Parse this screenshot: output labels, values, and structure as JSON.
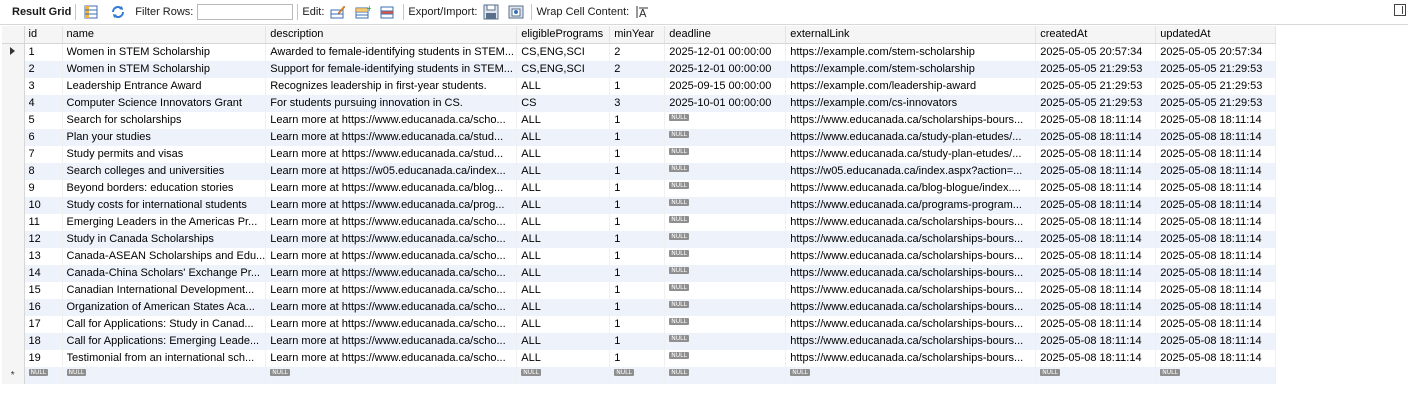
{
  "toolbar": {
    "result_grid": "Result Grid",
    "filter_rows": "Filter Rows:",
    "filter_value": "",
    "edit": "Edit:",
    "export_import": "Export/Import:",
    "wrap_cell": "Wrap Cell Content:"
  },
  "null_label": "NULL",
  "columns": [
    "id",
    "name",
    "description",
    "eligiblePrograms",
    "minYear",
    "deadline",
    "externalLink",
    "createdAt",
    "updatedAt"
  ],
  "rows": [
    [
      "1",
      "Women in STEM Scholarship",
      "Awarded to female-identifying students in STEM...",
      "CS,ENG,SCI",
      "2",
      "2025-12-01 00:00:00",
      "https://example.com/stem-scholarship",
      "2025-05-05 20:57:34",
      "2025-05-05 20:57:34"
    ],
    [
      "2",
      "Women in STEM Scholarship",
      "Support for female-identifying students in STEM...",
      "CS,ENG,SCI",
      "2",
      "2025-12-01 00:00:00",
      "https://example.com/stem-scholarship",
      "2025-05-05 21:29:53",
      "2025-05-05 21:29:53"
    ],
    [
      "3",
      "Leadership Entrance Award",
      "Recognizes leadership in first-year students.",
      "ALL",
      "1",
      "2025-09-15 00:00:00",
      "https://example.com/leadership-award",
      "2025-05-05 21:29:53",
      "2025-05-05 21:29:53"
    ],
    [
      "4",
      "Computer Science Innovators Grant",
      "For students pursuing innovation in CS.",
      "CS",
      "3",
      "2025-10-01 00:00:00",
      "https://example.com/cs-innovators",
      "2025-05-05 21:29:53",
      "2025-05-05 21:29:53"
    ],
    [
      "5",
      "Search for scholarships",
      "Learn more at https://www.educanada.ca/scho...",
      "ALL",
      "1",
      null,
      "https://www.educanada.ca/scholarships-bours...",
      "2025-05-08 18:11:14",
      "2025-05-08 18:11:14"
    ],
    [
      "6",
      "Plan your studies",
      "Learn more at https://www.educanada.ca/stud...",
      "ALL",
      "1",
      null,
      "https://www.educanada.ca/study-plan-etudes/...",
      "2025-05-08 18:11:14",
      "2025-05-08 18:11:14"
    ],
    [
      "7",
      "Study permits and visas",
      "Learn more at https://www.educanada.ca/stud...",
      "ALL",
      "1",
      null,
      "https://www.educanada.ca/study-plan-etudes/...",
      "2025-05-08 18:11:14",
      "2025-05-08 18:11:14"
    ],
    [
      "8",
      "Search colleges and universities",
      "Learn more at https://w05.educanada.ca/index...",
      "ALL",
      "1",
      null,
      "https://w05.educanada.ca/index.aspx?action=...",
      "2025-05-08 18:11:14",
      "2025-05-08 18:11:14"
    ],
    [
      "9",
      "Beyond borders: education stories",
      "Learn more at https://www.educanada.ca/blog...",
      "ALL",
      "1",
      null,
      "https://www.educanada.ca/blog-blogue/index....",
      "2025-05-08 18:11:14",
      "2025-05-08 18:11:14"
    ],
    [
      "10",
      "Study costs for international students",
      "Learn more at https://www.educanada.ca/prog...",
      "ALL",
      "1",
      null,
      "https://www.educanada.ca/programs-program...",
      "2025-05-08 18:11:14",
      "2025-05-08 18:11:14"
    ],
    [
      "11",
      "Emerging Leaders in the Americas Pr...",
      "Learn more at https://www.educanada.ca/scho...",
      "ALL",
      "1",
      null,
      "https://www.educanada.ca/scholarships-bours...",
      "2025-05-08 18:11:14",
      "2025-05-08 18:11:14"
    ],
    [
      "12",
      "Study in Canada Scholarships",
      "Learn more at https://www.educanada.ca/scho...",
      "ALL",
      "1",
      null,
      "https://www.educanada.ca/scholarships-bours...",
      "2025-05-08 18:11:14",
      "2025-05-08 18:11:14"
    ],
    [
      "13",
      "Canada-ASEAN Scholarships and Edu...",
      "Learn more at https://www.educanada.ca/scho...",
      "ALL",
      "1",
      null,
      "https://www.educanada.ca/scholarships-bours...",
      "2025-05-08 18:11:14",
      "2025-05-08 18:11:14"
    ],
    [
      "14",
      "Canada-China Scholars' Exchange Pr...",
      "Learn more at https://www.educanada.ca/scho...",
      "ALL",
      "1",
      null,
      "https://www.educanada.ca/scholarships-bours...",
      "2025-05-08 18:11:14",
      "2025-05-08 18:11:14"
    ],
    [
      "15",
      "Canadian International Development...",
      "Learn more at https://www.educanada.ca/scho...",
      "ALL",
      "1",
      null,
      "https://www.educanada.ca/scholarships-bours...",
      "2025-05-08 18:11:14",
      "2025-05-08 18:11:14"
    ],
    [
      "16",
      "Organization of American States Aca...",
      "Learn more at https://www.educanada.ca/scho...",
      "ALL",
      "1",
      null,
      "https://www.educanada.ca/scholarships-bours...",
      "2025-05-08 18:11:14",
      "2025-05-08 18:11:14"
    ],
    [
      "17",
      "Call for Applications: Study in Canad...",
      "Learn more at https://www.educanada.ca/scho...",
      "ALL",
      "1",
      null,
      "https://www.educanada.ca/scholarships-bours...",
      "2025-05-08 18:11:14",
      "2025-05-08 18:11:14"
    ],
    [
      "18",
      "Call for Applications: Emerging Leade...",
      "Learn more at https://www.educanada.ca/scho...",
      "ALL",
      "1",
      null,
      "https://www.educanada.ca/scholarships-bours...",
      "2025-05-08 18:11:14",
      "2025-05-08 18:11:14"
    ],
    [
      "19",
      "Testimonial from an international sch...",
      "Learn more at https://www.educanada.ca/scho...",
      "ALL",
      "1",
      null,
      "https://www.educanada.ca/scholarships-bours...",
      "2025-05-08 18:11:14",
      "2025-05-08 18:11:14"
    ]
  ],
  "new_row_marker": "*"
}
